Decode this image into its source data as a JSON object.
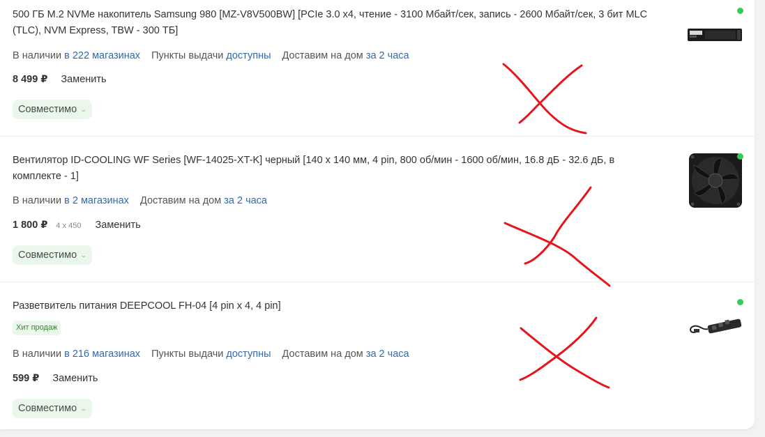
{
  "items": [
    {
      "title": "500 ГБ M.2 NVMe накопитель Samsung 980 [MZ-V8V500BW] [PCIe 3.0 x4, чтение - 3100 Мбайт/сек, запись - 2600 Мбайт/сек, 3 бит MLC (TLC), NVM Express, TBW - 300 ТБ]",
      "availability": {
        "in_stock_label": "В наличии",
        "in_stock_link": "в 222 магазинах",
        "pickup_label": "Пункты выдачи",
        "pickup_link": "доступны",
        "delivery_label": "Доставим на дом",
        "delivery_link": "за 2 часа"
      },
      "price": "8 499 ₽",
      "replace_label": "Заменить",
      "compat_label": "Совместимо",
      "image_icon": "ssd-icon",
      "status_color": "#33cc55"
    },
    {
      "title": "Вентилятор ID-COOLING WF Series [WF-14025-XT-K] черный [140 x 140 мм, 4 pin, 800 об/мин - 1600 об/мин, 16.8 дБ - 32.6 дБ, в комплекте - 1]",
      "availability": {
        "in_stock_label": "В наличии",
        "in_stock_link": "в 2 магазинах",
        "delivery_label": "Доставим на дом",
        "delivery_link": "за 2 часа"
      },
      "price": "1 800 ₽",
      "quantity_note": "4 x 450",
      "replace_label": "Заменить",
      "compat_label": "Совместимо",
      "image_icon": "fan-icon",
      "status_color": "#33cc55"
    },
    {
      "title": "Разветвитель питания DEEPCOOL FH-04 [4 pin x 4, 4 pin]",
      "badge": "Хит продаж",
      "availability": {
        "in_stock_label": "В наличии",
        "in_stock_link": "в 216 магазинах",
        "pickup_label": "Пункты выдачи",
        "pickup_link": "доступны",
        "delivery_label": "Доставим на дом",
        "delivery_link": "за 2 часа"
      },
      "price": "599 ₽",
      "replace_label": "Заменить",
      "compat_label": "Совместимо",
      "image_icon": "splitter-icon",
      "status_color": "#33cc55"
    }
  ],
  "annotation_color": "#e8141c",
  "accent_link_color": "#2f6ab3",
  "compat_bg_color": "#eaf7ea"
}
